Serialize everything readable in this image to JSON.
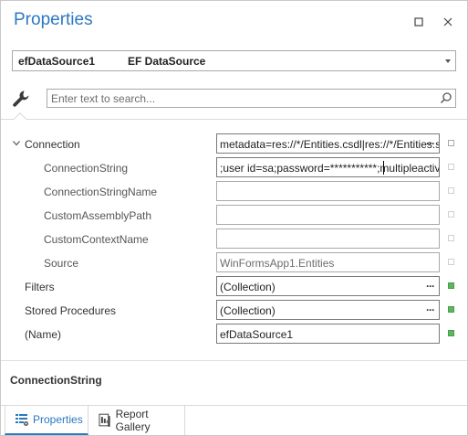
{
  "window": {
    "title": "Properties",
    "restore_icon": "restore-icon",
    "close_icon": "close-icon"
  },
  "object_selector": {
    "name": "efDataSource1",
    "type": "EF DataSource"
  },
  "search": {
    "placeholder": "Enter text to search...",
    "value": ""
  },
  "properties": [
    {
      "name": "Connection",
      "value": "metadata=res://*/Entities.csdl|res://*/Entities.ssdl|res://*/Entities.msl",
      "expanded": true,
      "has_ellipsis": true
    },
    {
      "name": "ConnectionString",
      "value": ";user id=sa;password=***********;multipleactiveresultsets=True",
      "focused": true
    },
    {
      "name": "ConnectionStringName",
      "value": ""
    },
    {
      "name": "CustomAssemblyPath",
      "value": ""
    },
    {
      "name": "CustomContextName",
      "value": ""
    },
    {
      "name": "Source",
      "value": "WinFormsApp1.Entities",
      "readonly": true
    },
    {
      "name": "Filters",
      "value": "(Collection)",
      "has_ellipsis": true,
      "modified": true
    },
    {
      "name": "Stored Procedures",
      "value": "(Collection)",
      "has_ellipsis": true,
      "modified": true
    },
    {
      "name": "(Name)",
      "value": "efDataSource1",
      "modified": true
    }
  ],
  "description": {
    "title": "ConnectionString"
  },
  "tabs": [
    {
      "label": "Properties",
      "icon": "properties-grid-icon",
      "active": true
    },
    {
      "label": "Report Gallery",
      "icon": "report-gallery-icon",
      "active": false
    }
  ],
  "colors": {
    "accent": "#2b78c2",
    "modified_marker": "#5cb85c"
  }
}
